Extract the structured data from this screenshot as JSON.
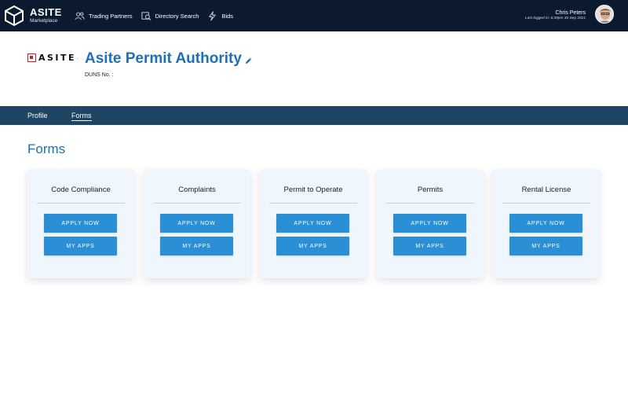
{
  "topbar": {
    "brand_name": "ASITE",
    "brand_sub": "Marketplace",
    "nav": [
      {
        "label": "Trading Partners",
        "icon": "users-icon"
      },
      {
        "label": "Directory Search",
        "icon": "directory-search-icon"
      },
      {
        "label": "Bids",
        "icon": "lightning-icon"
      }
    ],
    "user_name": "Chris Peters",
    "last_logged": "Last logged in: 6:39pm 30 Sep 2021"
  },
  "header": {
    "logo_text": "ASITE",
    "title": "Asite Permit Authority",
    "duns_label": "DUNS No. :"
  },
  "tabs": [
    {
      "label": "Profile",
      "active": false
    },
    {
      "label": "Forms",
      "active": true
    }
  ],
  "main": {
    "heading": "Forms",
    "cards": [
      {
        "title": "Code Compliance",
        "apply_label": "APPLY NOW",
        "myapps_label": "MY APPS"
      },
      {
        "title": "Complaints",
        "apply_label": "APPLY NOW",
        "myapps_label": "MY APPS"
      },
      {
        "title": "Permit to Operate",
        "apply_label": "APPLY NOW",
        "myapps_label": "MY APPS"
      },
      {
        "title": "Permits",
        "apply_label": "APPLY NOW",
        "myapps_label": "MY APPS"
      },
      {
        "title": "Rental License",
        "apply_label": "APPLY NOW",
        "myapps_label": "MY APPS"
      }
    ]
  },
  "colors": {
    "topbar_bg": "#0c1a30",
    "tabsbar_bg": "#1e4664",
    "accent_blue": "#1e6fb5",
    "button_blue": "#2a8fd4",
    "card_bg": "#f0f7fc"
  }
}
